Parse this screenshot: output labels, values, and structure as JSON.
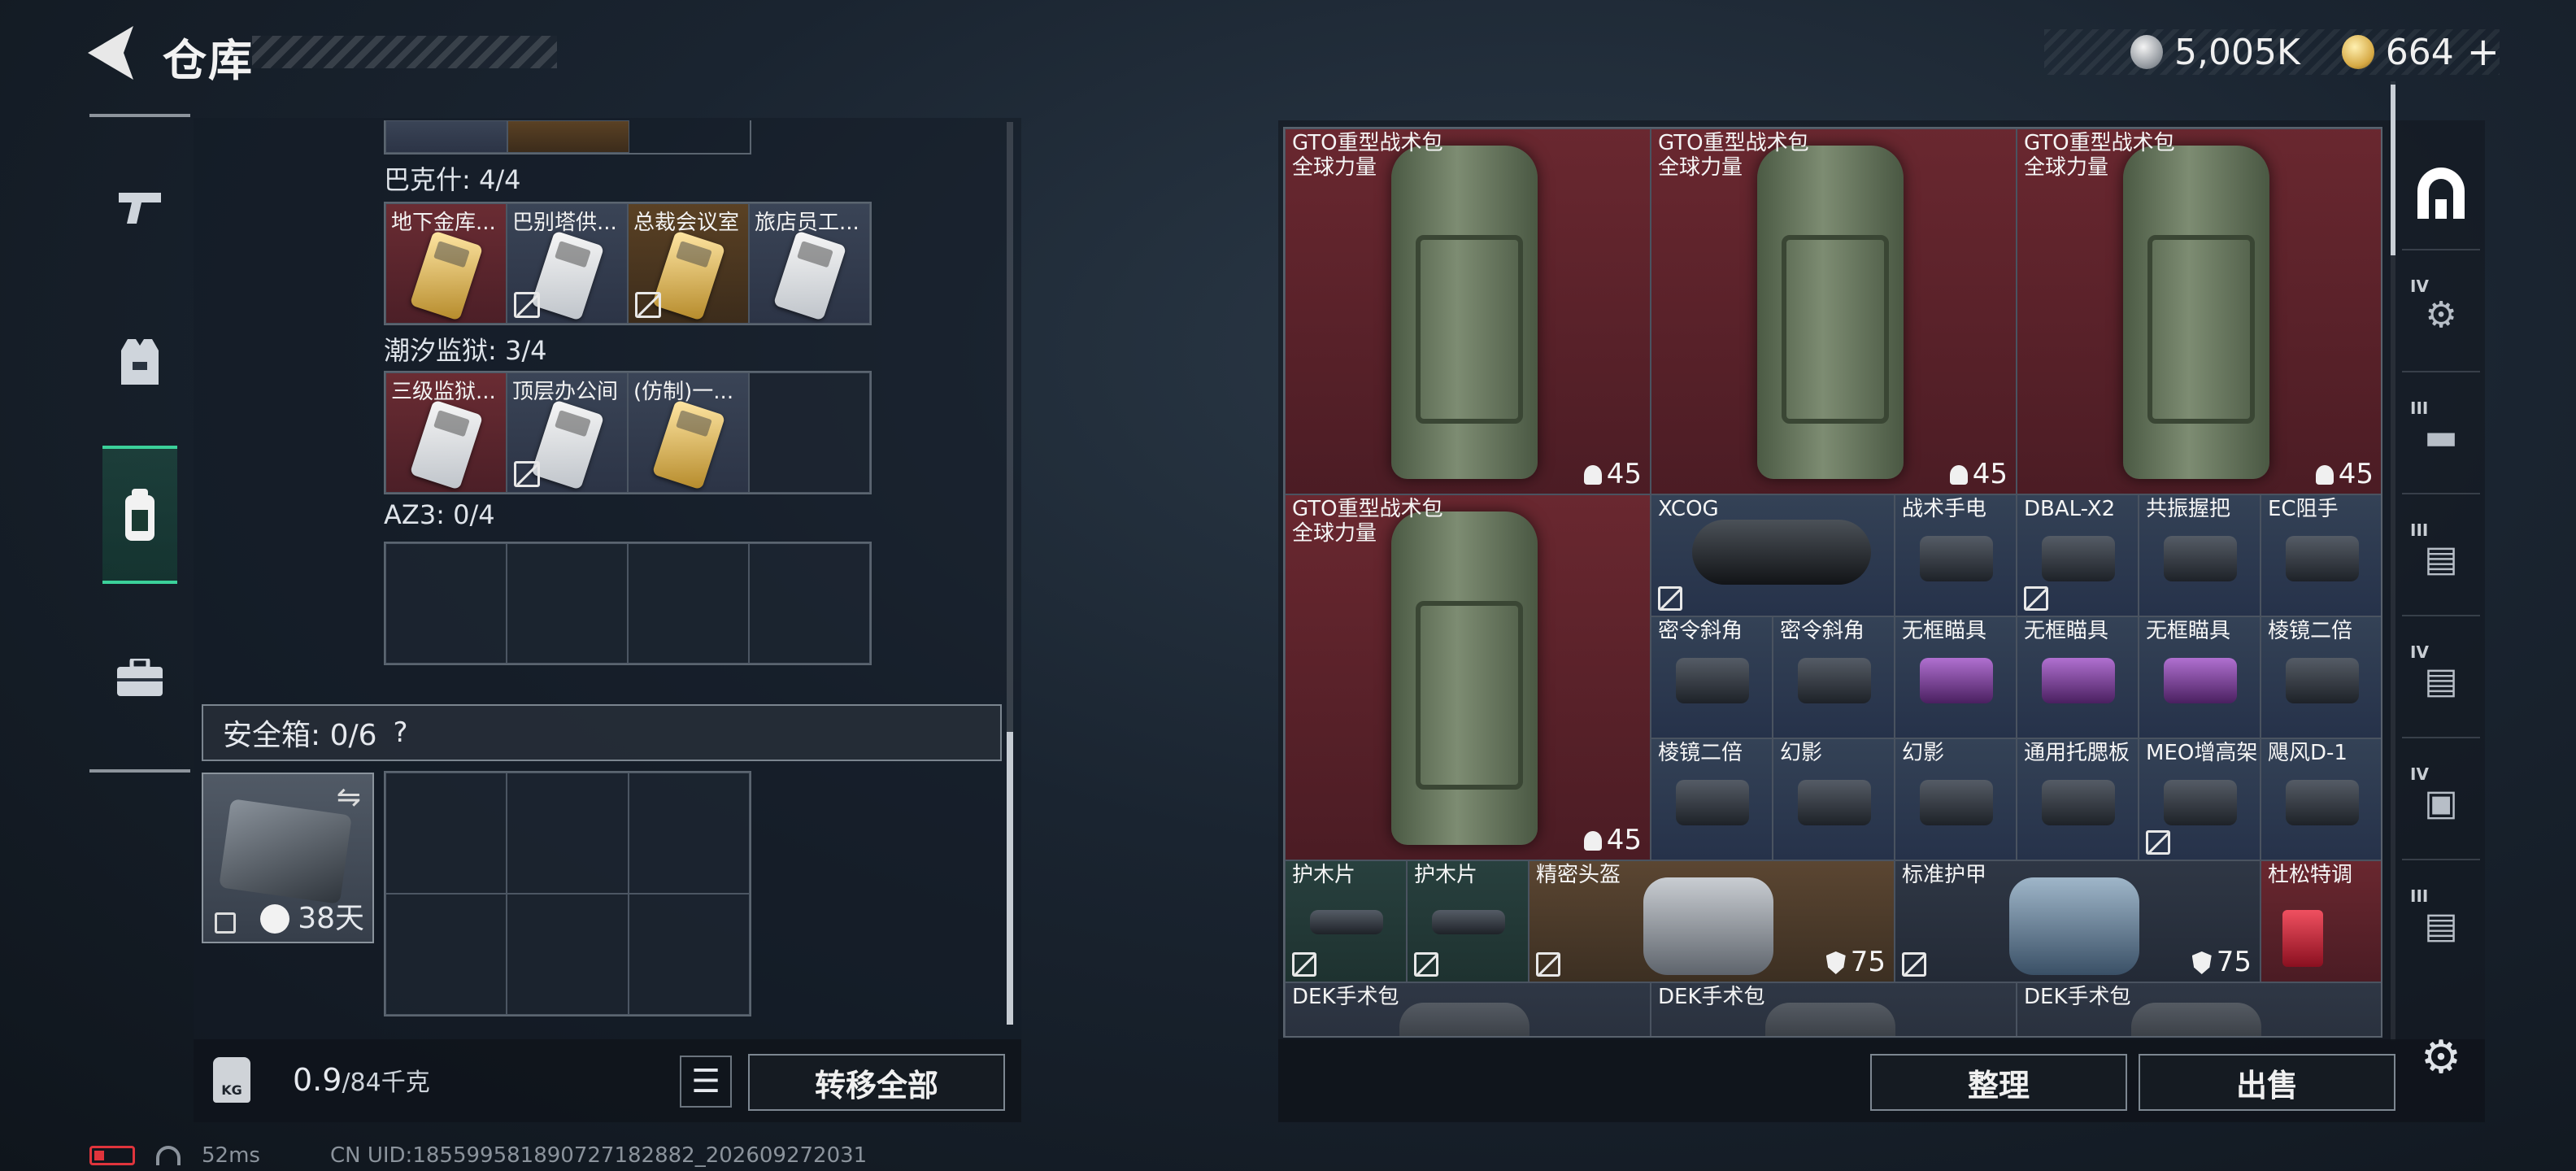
{
  "header": {
    "title": "仓库"
  },
  "currency": {
    "silver": "5,005K",
    "gold": "664",
    "plus": "+"
  },
  "left": {
    "sections": [
      {
        "label": "巴克什: 4/4",
        "cards": [
          "地下金库...",
          "巴别塔供...",
          "总裁会议室",
          "旅店员工..."
        ]
      },
      {
        "label": "潮汐监狱: 3/4",
        "cards": [
          "三级监狱...",
          "顶层办公间",
          "(仿制)一..."
        ]
      },
      {
        "label": "AZ3: 0/4",
        "cards": []
      }
    ],
    "safe_label": "安全箱: 0/6",
    "help": "?",
    "timer": "38天",
    "weight_value": "0.9",
    "weight_unit": "/84千克",
    "transfer_all": "转移全部",
    "weight_icon_text": "KG"
  },
  "stash": {
    "items": [
      {
        "name": "GTO重型战术包",
        "sub": "全球力量",
        "count": "45"
      },
      {
        "name": "GTO重型战术包",
        "sub": "全球力量",
        "count": "45"
      },
      {
        "name": "GTO重型战术包",
        "sub": "全球力量",
        "count": "45"
      },
      {
        "name": "GTO重型战术包",
        "sub": "全球力量",
        "count": "45"
      }
    ],
    "small": [
      "XCOG",
      "战术手电",
      "DBAL-X2",
      "共振握把",
      "EC阻手",
      "密令斜角",
      "密令斜角",
      "无框瞄具",
      "无框瞄具",
      "无框瞄具",
      "棱镜二倍",
      "棱镜二倍",
      "幻影",
      "幻影",
      "通用托腮板",
      "MEO增高架",
      "飓风D-1"
    ],
    "bottom_row": [
      "护木片",
      "护木片",
      "精密头盔",
      "标准护甲",
      "杜松特调"
    ],
    "armor_count": "75",
    "helmet_count": "75",
    "dek": [
      "DEK手术包",
      "DEK手术包",
      "DEK手术包"
    ]
  },
  "actions": {
    "sort": "整理",
    "sell": "出售"
  },
  "status": {
    "ping": "52ms",
    "uid": "CN UID:18559958189072718288​2_202609272031"
  },
  "icons": [
    "back-icon",
    "pistol-icon",
    "vest-icon",
    "backpack-icon",
    "toolbox-icon",
    "gear-icon"
  ]
}
